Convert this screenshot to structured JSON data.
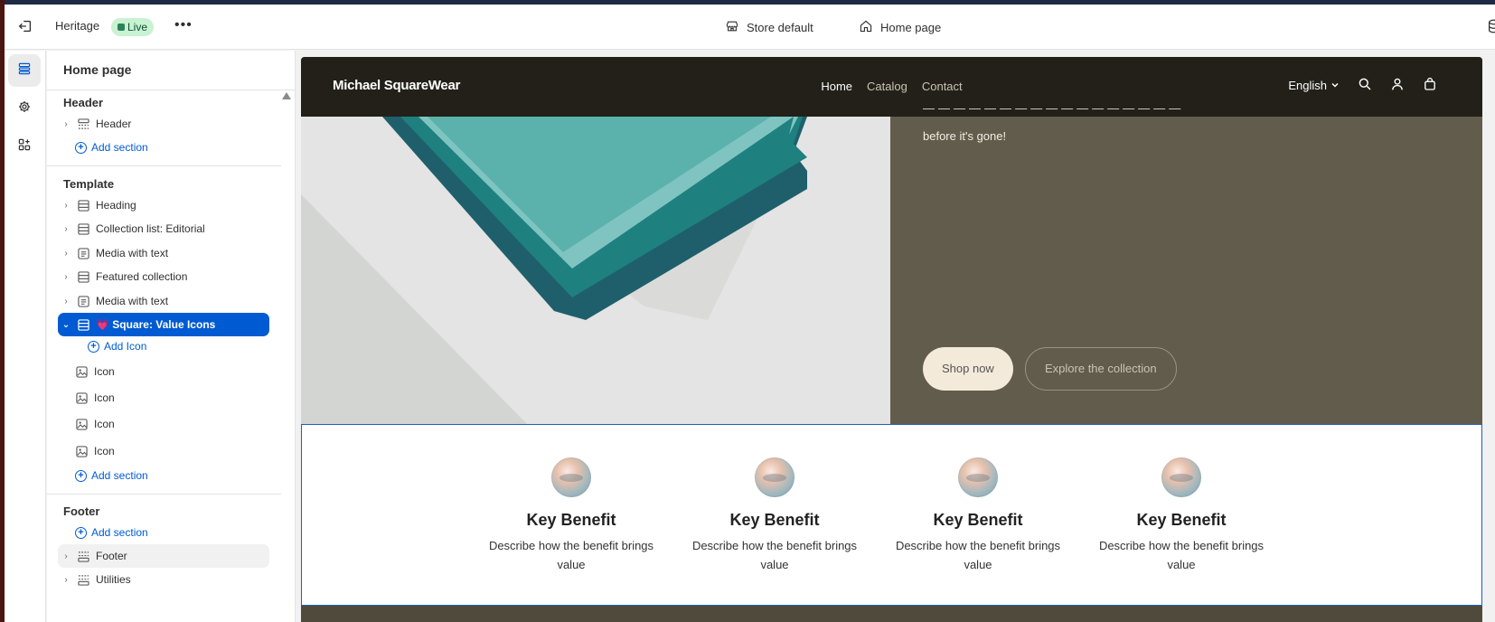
{
  "topbar": {
    "theme_name": "Heritage",
    "live_badge": "Live",
    "more": "•••",
    "context_store": "Store default",
    "context_page": "Home page"
  },
  "sidebar": {
    "title": "Home page",
    "header_group": {
      "title": "Header",
      "items": [
        {
          "label": "Header"
        }
      ],
      "add_label": "Add section"
    },
    "template_group": {
      "title": "Template",
      "items": [
        {
          "label": "Heading"
        },
        {
          "label": "Collection list: Editorial"
        },
        {
          "label": "Media with text"
        },
        {
          "label": "Featured collection"
        },
        {
          "label": "Media with text"
        },
        {
          "label": "💗 Square: Value Icons"
        }
      ],
      "add_icon_label": "Add Icon",
      "blocks": [
        {
          "label": "Icon"
        },
        {
          "label": "Icon"
        },
        {
          "label": "Icon"
        },
        {
          "label": "Icon"
        }
      ],
      "add_label": "Add section"
    },
    "footer_group": {
      "title": "Footer",
      "add_label": "Add section",
      "items": [
        {
          "label": "Footer"
        },
        {
          "label": "Utilities"
        }
      ]
    }
  },
  "preview": {
    "brand": "Michael SquareWear",
    "menu": [
      "Home",
      "Catalog",
      "Contact"
    ],
    "language": "English",
    "hero_text": "before it's gone!",
    "primary_button": "Shop now",
    "secondary_button": "Explore the collection",
    "benefits": [
      {
        "title": "Key Benefit",
        "desc": "Describe how the benefit brings value"
      },
      {
        "title": "Key Benefit",
        "desc": "Describe how the benefit brings value"
      },
      {
        "title": "Key Benefit",
        "desc": "Describe how the benefit brings value"
      },
      {
        "title": "Key Benefit",
        "desc": "Describe how the benefit brings value"
      }
    ]
  },
  "colors": {
    "accent": "#005bd3",
    "nav_bg": "#222019",
    "hero_right_bg": "#625c4c",
    "live_bg": "#c9f2d3"
  }
}
